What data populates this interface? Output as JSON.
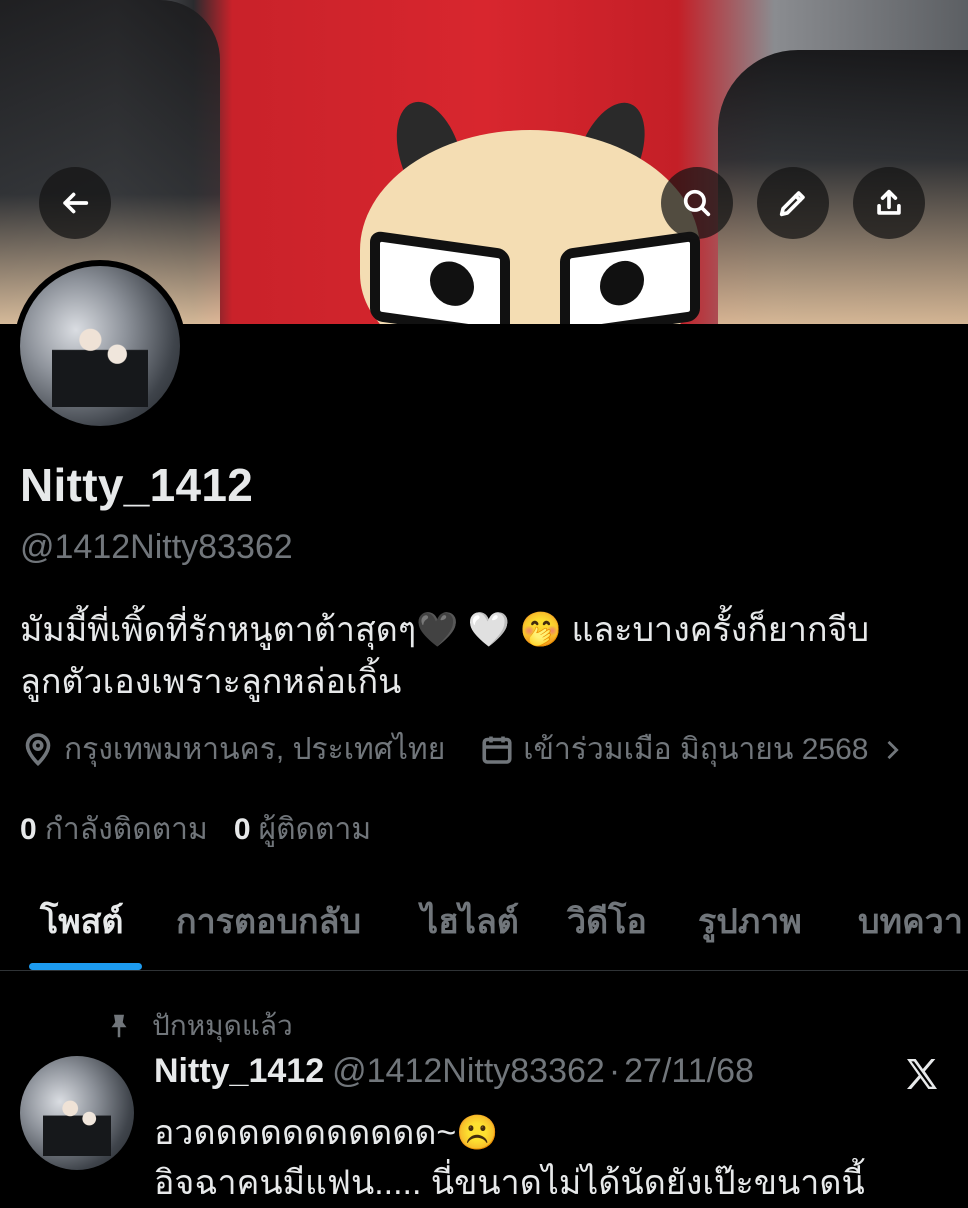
{
  "profile": {
    "display_name": "Nitty_1412",
    "handle": "@1412Nitty83362",
    "bio_line1": "มัมมี้พี่เพิ้ดที่รักหนูตาต้าสุดๆ🖤 🤍 🤭 และบางครั้งก็ยากจีบ",
    "bio_line2": "ลูกตัวเองเพราะลูกหล่อเกิ้น",
    "location": "กรุงเทพมหานคร, ประเทศไทย",
    "joined": "เข้าร่วมเมือ มิถุนายน 2568",
    "following_count": "0",
    "following_label": "กำลังติดตาม",
    "followers_count": "0",
    "followers_label": "ผู้ติดตาม"
  },
  "header_icons": {
    "back": "arrow-left-icon",
    "search": "search-icon",
    "edit": "pencil-icon",
    "share": "share-icon"
  },
  "tabs": [
    {
      "label": "โพสต์",
      "active": true
    },
    {
      "label": "การตอบกลับ",
      "active": false
    },
    {
      "label": "ไฮไลต์",
      "active": false
    },
    {
      "label": "วิดีโอ",
      "active": false
    },
    {
      "label": "รูปภาพ",
      "active": false
    },
    {
      "label": "บทควา",
      "active": false
    }
  ],
  "post": {
    "pinned_label": "ปักหมุดแล้ว",
    "author_name": "Nitty_1412",
    "author_handle": "@1412Nitty83362",
    "separator": "·",
    "date": "27/11/68",
    "line1": "อวดดดดดดดดดดด~☹️",
    "line2": "อิจฉาคนมีแฟน..... นี่ขนาดไม่ได้นัดยังเป๊ะขนาดนี้"
  },
  "colors": {
    "background": "#000000",
    "text": "#e7e9ea",
    "muted": "#71767b",
    "accent": "#1d9bf0"
  }
}
